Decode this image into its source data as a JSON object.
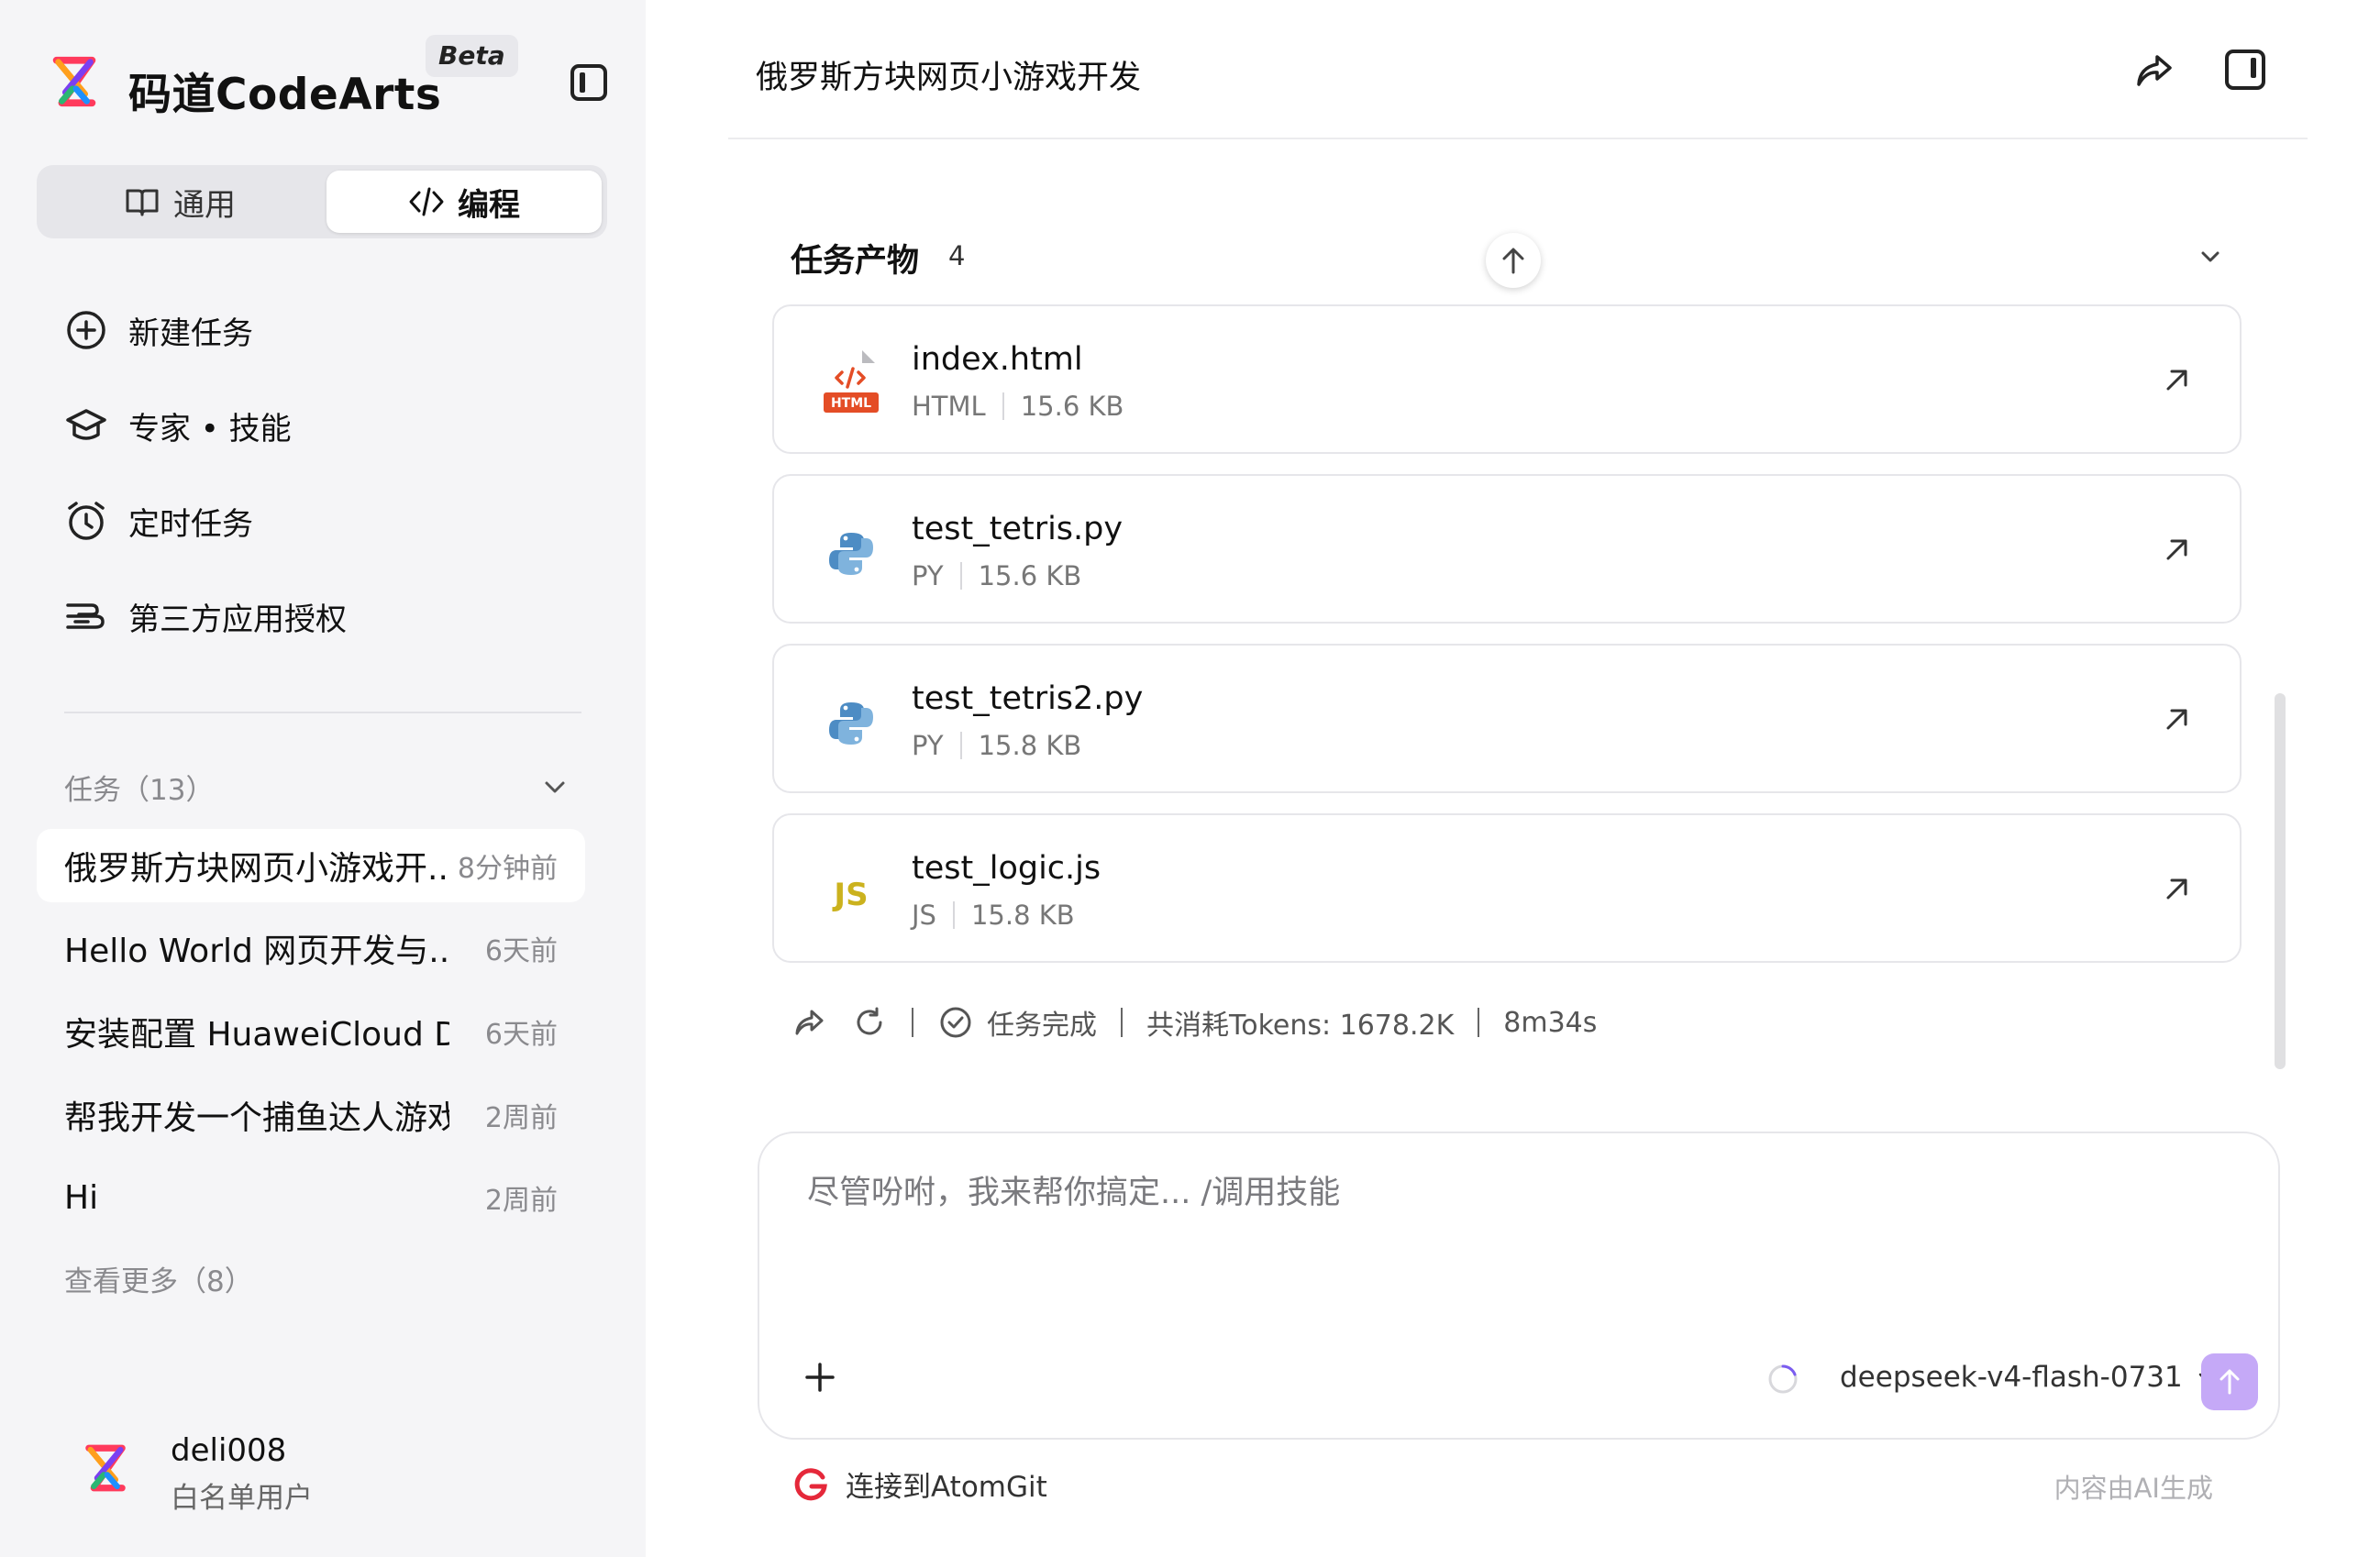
{
  "sidebar": {
    "app_title": "码道CodeArts",
    "beta_badge": "Beta",
    "modes": [
      {
        "label": "通用"
      },
      {
        "label": "编程"
      }
    ],
    "nav": [
      {
        "label": "新建任务",
        "icon": "plus-circle-icon"
      },
      {
        "label": "专家 • 技能",
        "icon": "graduation-cap-icon"
      },
      {
        "label": "定时任务",
        "icon": "alarm-clock-icon"
      },
      {
        "label": "第三方应用授权",
        "icon": "hand-authorize-icon"
      }
    ],
    "tasks_header": "任务（13）",
    "tasks": [
      {
        "name": "俄罗斯方块网页小游戏开...",
        "time": "8分钟前",
        "active": true
      },
      {
        "name": "Hello World 网页开发与...",
        "time": "6天前"
      },
      {
        "name": "安装配置 HuaweiCloud D...",
        "time": "6天前"
      },
      {
        "name": "帮我开发一个捕鱼达人游戏",
        "time": "2周前"
      },
      {
        "name": "Hi",
        "time": "2周前"
      }
    ],
    "see_more": "查看更多（8）",
    "user": {
      "name": "deli008",
      "role": "白名单用户"
    }
  },
  "main": {
    "title": "俄罗斯方块网页小游戏开发",
    "artifacts": {
      "title": "任务产物",
      "count": "4",
      "files": [
        {
          "name": "index.html",
          "type": "HTML",
          "size": "15.6 KB",
          "icon": "html-file-icon"
        },
        {
          "name": "test_tetris.py",
          "type": "PY",
          "size": "15.6 KB",
          "icon": "python-file-icon"
        },
        {
          "name": "test_tetris2.py",
          "type": "PY",
          "size": "15.8 KB",
          "icon": "python-file-icon"
        },
        {
          "name": "test_logic.js",
          "type": "JS",
          "size": "15.8 KB",
          "icon": "js-file-icon"
        }
      ]
    },
    "status": {
      "completed": "任务完成",
      "tokens": "共消耗Tokens: 1678.2K",
      "duration": "8m34s"
    },
    "input": {
      "placeholder": "尽管吩咐，我来帮你搞定... /调用技能",
      "model": "deepseek-v4-flash-0731"
    },
    "footer": {
      "connect": "连接到AtomGit",
      "ai_note": "内容由AI生成"
    }
  },
  "colors": {
    "sidebar_bg": "#f5f5f7",
    "send_button": "#c5a9f7",
    "html_red": "#e44d26",
    "python_blue": "#4d8cc4",
    "js_yellow": "#cbb21e"
  }
}
